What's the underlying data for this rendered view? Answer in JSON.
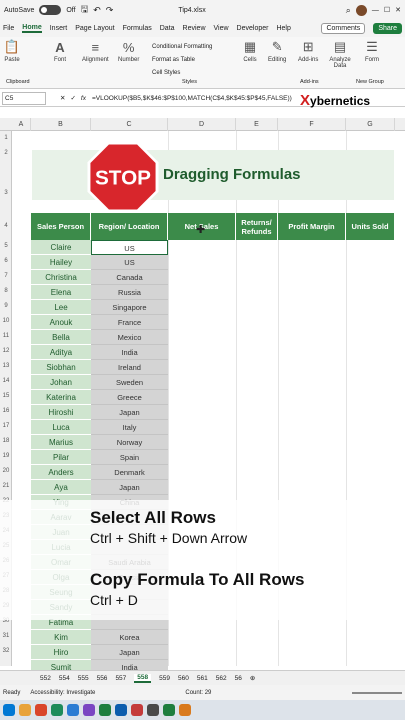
{
  "titlebar": {
    "autosave": "AutoSave",
    "toggle": "Off",
    "filename": "Tip4.xlsx"
  },
  "tabs": [
    "File",
    "Home",
    "Insert",
    "Page Layout",
    "Formulas",
    "Data",
    "Review",
    "View",
    "Developer",
    "Help"
  ],
  "buttons": {
    "comments": "Comments",
    "share": "Share"
  },
  "ribbon": {
    "paste": "Paste",
    "clipboard": "Clipboard",
    "font": "Font",
    "alignment": "Alignment",
    "number": "Number",
    "cond": "Conditional Formatting",
    "table": "Format as Table",
    "styles_btn": "Cell Styles",
    "styles": "Styles",
    "cells": "Cells",
    "editing": "Editing",
    "addins": "Add-ins",
    "analyze": "Analyze Data",
    "form": "Form",
    "addins_grp": "Add-ins",
    "newgroup": "New Group"
  },
  "formula_bar": {
    "cell": "C5",
    "fx": "fx",
    "formula": "=VLOOKUP($B5,$K$46:$P$100,MATCH(C$4,$K$45:$P$45,FALSE))"
  },
  "watermark": "ybernetics",
  "columns": [
    "A",
    "B",
    "C",
    "D",
    "E",
    "F",
    "G"
  ],
  "rows": [
    "1",
    "2",
    "3",
    "4",
    "5",
    "6",
    "7",
    "8",
    "9",
    "10",
    "11",
    "12",
    "13",
    "14",
    "15",
    "16",
    "17",
    "18",
    "19",
    "20",
    "21",
    "22",
    "23",
    "24",
    "25",
    "26",
    "27",
    "28",
    "29",
    "30",
    "31",
    "32",
    "33"
  ],
  "banner": {
    "stop": "STOP",
    "title": "Dragging Formulas"
  },
  "headers": [
    "Sales Person",
    "Region/ Location",
    "Net Sales",
    "Returns/ Refunds",
    "Profit Margin",
    "Units Sold"
  ],
  "people": [
    "Claire",
    "Hailey",
    "Christina",
    "Elena",
    "Lee",
    "Anouk",
    "Bella",
    "Aditya",
    "Siobhan",
    "Johan",
    "Katerina",
    "Hiroshi",
    "Luca",
    "Marius",
    "Pilar",
    "Anders",
    "Aya",
    "Ying",
    "Aarav",
    "Juan",
    "Lucia",
    "Omar",
    "Olga",
    "Seung",
    "Sandy",
    "Fatima",
    "Kim",
    "Hiro",
    "Sumit"
  ],
  "regions": [
    "US",
    "US",
    "Canada",
    "Russia",
    "Singapore",
    "France",
    "Mexico",
    "India",
    "Ireland",
    "Sweden",
    "Greece",
    "Japan",
    "Italy",
    "Norway",
    "Spain",
    "Denmark",
    "Japan",
    "China",
    "",
    "",
    "",
    "Saudi Arabia",
    "Russia",
    "",
    "",
    "",
    "Korea",
    "Japan",
    "India"
  ],
  "overlay": {
    "line1": "Select All Rows",
    "line2": "Ctrl + Shift + Down Arrow",
    "line3": "Copy Formula To All Rows",
    "line4": "Ctrl + D"
  },
  "sheets": [
    "552",
    "554",
    "555",
    "556",
    "557",
    "558",
    "559",
    "560",
    "561",
    "562",
    "56"
  ],
  "status": {
    "ready": "Ready",
    "access": "Accessibility: Investigate",
    "count": "Count: 29"
  },
  "colors": {
    "green": "#3c8b4a",
    "dark_green": "#1f5c2d",
    "light_green": "#cfe5cf",
    "grey": "#d4d4d4"
  }
}
